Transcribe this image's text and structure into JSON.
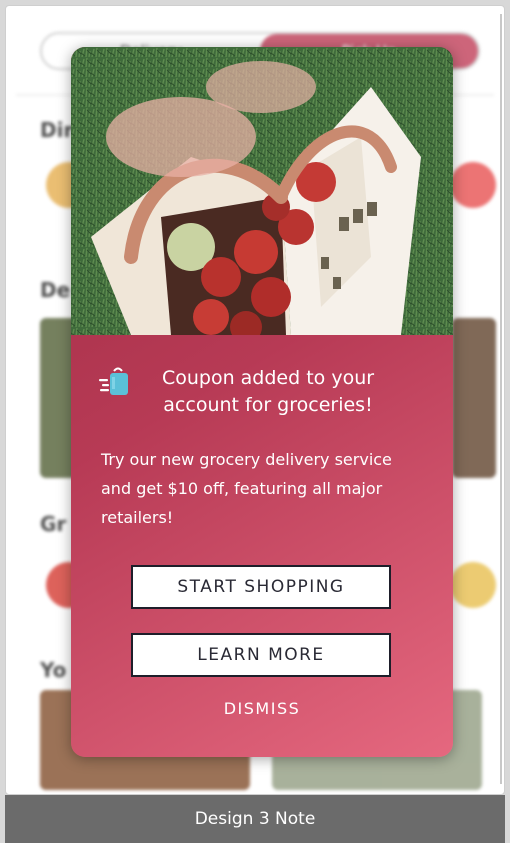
{
  "background_app": {
    "segments": [
      "Delivery",
      "Pick Up"
    ],
    "headings": [
      "Dir",
      "De",
      "Gr",
      "Yo"
    ]
  },
  "modal": {
    "coupon_icon": "shopping-bag-speed-icon",
    "coupon_title": "Coupon added to your account for groceries!",
    "body": "Try our new grocery delivery service and get $10 off, featuring all major retailers!",
    "start_button": "START SHOPPING",
    "learn_button": "LEARN MORE",
    "dismiss": "DISMISS"
  },
  "note": {
    "label": "Design 3 Note"
  },
  "colors": {
    "accent": "#c54a63",
    "modal_gradient_start": "#9e2c43",
    "modal_gradient_end": "#e5687f",
    "note_bar": "#6b6b6b"
  }
}
